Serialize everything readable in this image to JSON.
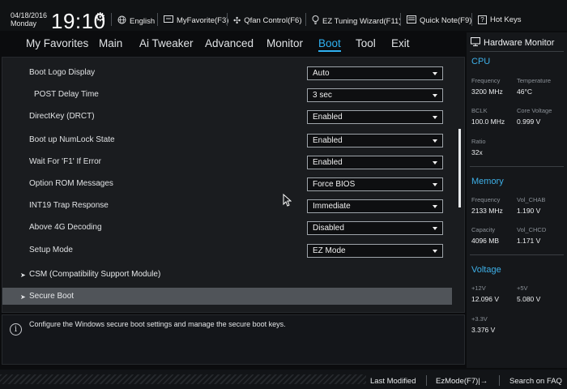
{
  "topbar": {
    "date": "04/18/2016",
    "day": "Monday",
    "time": "19:10",
    "language": "English",
    "myfavorite": "MyFavorite(F3)",
    "qfan": "Qfan Control(F6)",
    "ez_tuning": "EZ Tuning Wizard(F11)",
    "quick_note": "Quick Note(F9)",
    "hot_keys": "Hot Keys"
  },
  "tabs": {
    "favorites": "My Favorites",
    "main": "Main",
    "ai_tweaker": "Ai Tweaker",
    "advanced": "Advanced",
    "monitor": "Monitor",
    "boot": "Boot",
    "tool": "Tool",
    "exit": "Exit"
  },
  "settings": {
    "boot_logo_label": "Boot Logo Display",
    "boot_logo_value": "Auto",
    "post_delay_label": "POST Delay Time",
    "post_delay_value": "3 sec",
    "directkey_label": "DirectKey (DRCT)",
    "directkey_value": "Enabled",
    "numlock_label": "Boot up NumLock State",
    "numlock_value": "Enabled",
    "wait_f1_label": "Wait For 'F1' If Error",
    "wait_f1_value": "Enabled",
    "option_rom_label": "Option ROM Messages",
    "option_rom_value": "Force BIOS",
    "int19_label": "INT19 Trap Response",
    "int19_value": "Immediate",
    "above4g_label": "Above 4G Decoding",
    "above4g_value": "Disabled",
    "setup_mode_label": "Setup Mode",
    "setup_mode_value": "EZ Mode",
    "csm_label": "CSM (Compatibility Support Module)",
    "secure_boot_label": "Secure Boot"
  },
  "help": {
    "text": "Configure the Windows secure boot settings and manage the secure boot keys."
  },
  "hardware_monitor": {
    "title": "Hardware Monitor",
    "cpu": {
      "section": "CPU",
      "frequency_label": "Frequency",
      "frequency_value": "3200 MHz",
      "temperature_label": "Temperature",
      "temperature_value": "46°C",
      "bclk_label": "BCLK",
      "bclk_value": "100.0 MHz",
      "core_voltage_label": "Core Voltage",
      "core_voltage_value": "0.999 V",
      "ratio_label": "Ratio",
      "ratio_value": "32x"
    },
    "memory": {
      "section": "Memory",
      "frequency_label": "Frequency",
      "frequency_value": "2133 MHz",
      "vol_chab_label": "Vol_CHAB",
      "vol_chab_value": "1.190 V",
      "capacity_label": "Capacity",
      "capacity_value": "4096 MB",
      "vol_chcd_label": "Vol_CHCD",
      "vol_chcd_value": "1.171 V"
    },
    "voltage": {
      "section": "Voltage",
      "v12_label": "+12V",
      "v12_value": "12.096 V",
      "v5_label": "+5V",
      "v5_value": "5.080 V",
      "v33_label": "+3.3V",
      "v33_value": "3.376 V"
    }
  },
  "bottom": {
    "last_modified": "Last Modified",
    "ezmode": "EzMode(F7)|→",
    "search_faq": "Search on FAQ"
  },
  "colors": {
    "accent": "#2fb0f0",
    "section_blue": "#3eb0e8",
    "highlight_row": "#505459"
  },
  "icons": [
    "gear-icon",
    "globe-icon",
    "favorite-icon",
    "fan-icon",
    "bulb-icon",
    "note-icon",
    "help-icon",
    "monitor-icon",
    "info-icon",
    "chevron-right-icon",
    "mouse-cursor-icon"
  ]
}
